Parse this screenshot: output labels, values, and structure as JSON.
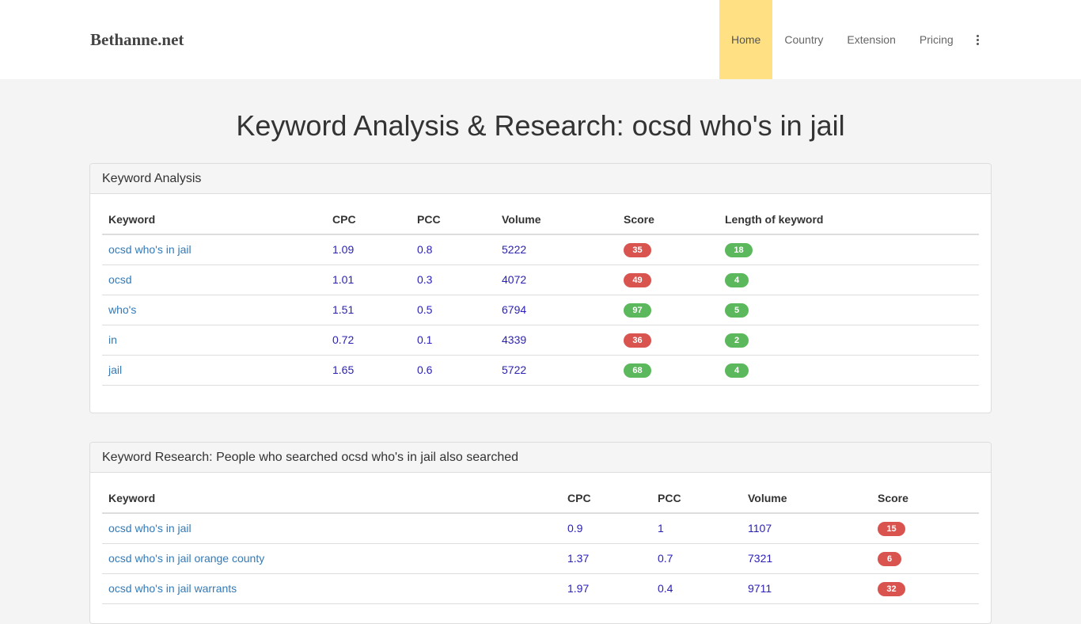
{
  "brand": "Bethanne.net",
  "nav": {
    "items": [
      {
        "label": "Home",
        "active": true
      },
      {
        "label": "Country",
        "active": false
      },
      {
        "label": "Extension",
        "active": false
      },
      {
        "label": "Pricing",
        "active": false
      }
    ],
    "more_icon": "vertical-ellipsis-icon"
  },
  "page_title": "Keyword Analysis & Research: ocsd who's in jail",
  "analysis": {
    "heading": "Keyword Analysis",
    "columns": [
      "Keyword",
      "CPC",
      "PCC",
      "Volume",
      "Score",
      "Length of keyword"
    ],
    "rows": [
      {
        "keyword": "ocsd who's in jail",
        "cpc": "1.09",
        "pcc": "0.8",
        "volume": "5222",
        "score": "35",
        "length": "18"
      },
      {
        "keyword": "ocsd",
        "cpc": "1.01",
        "pcc": "0.3",
        "volume": "4072",
        "score": "49",
        "length": "4"
      },
      {
        "keyword": "who's",
        "cpc": "1.51",
        "pcc": "0.5",
        "volume": "6794",
        "score": "97",
        "length": "5"
      },
      {
        "keyword": "in",
        "cpc": "0.72",
        "pcc": "0.1",
        "volume": "4339",
        "score": "36",
        "length": "2"
      },
      {
        "keyword": "jail",
        "cpc": "1.65",
        "pcc": "0.6",
        "volume": "5722",
        "score": "68",
        "length": "4"
      }
    ],
    "score_colors": [
      "red",
      "red",
      "green",
      "red",
      "green"
    ]
  },
  "research": {
    "heading": "Keyword Research: People who searched ocsd who's in jail also searched",
    "columns": [
      "Keyword",
      "CPC",
      "PCC",
      "Volume",
      "Score"
    ],
    "rows": [
      {
        "keyword": "ocsd who's in jail",
        "cpc": "0.9",
        "pcc": "1",
        "volume": "1107",
        "score": "15"
      },
      {
        "keyword": "ocsd who's in jail orange county",
        "cpc": "1.37",
        "pcc": "0.7",
        "volume": "7321",
        "score": "6"
      },
      {
        "keyword": "ocsd who's in jail warrants",
        "cpc": "1.97",
        "pcc": "0.4",
        "volume": "9711",
        "score": "32"
      }
    ]
  },
  "colors": {
    "active_nav": "#ffe082",
    "badge_red": "#d9534f",
    "badge_green": "#5cb85c",
    "link": "#337ab7"
  }
}
